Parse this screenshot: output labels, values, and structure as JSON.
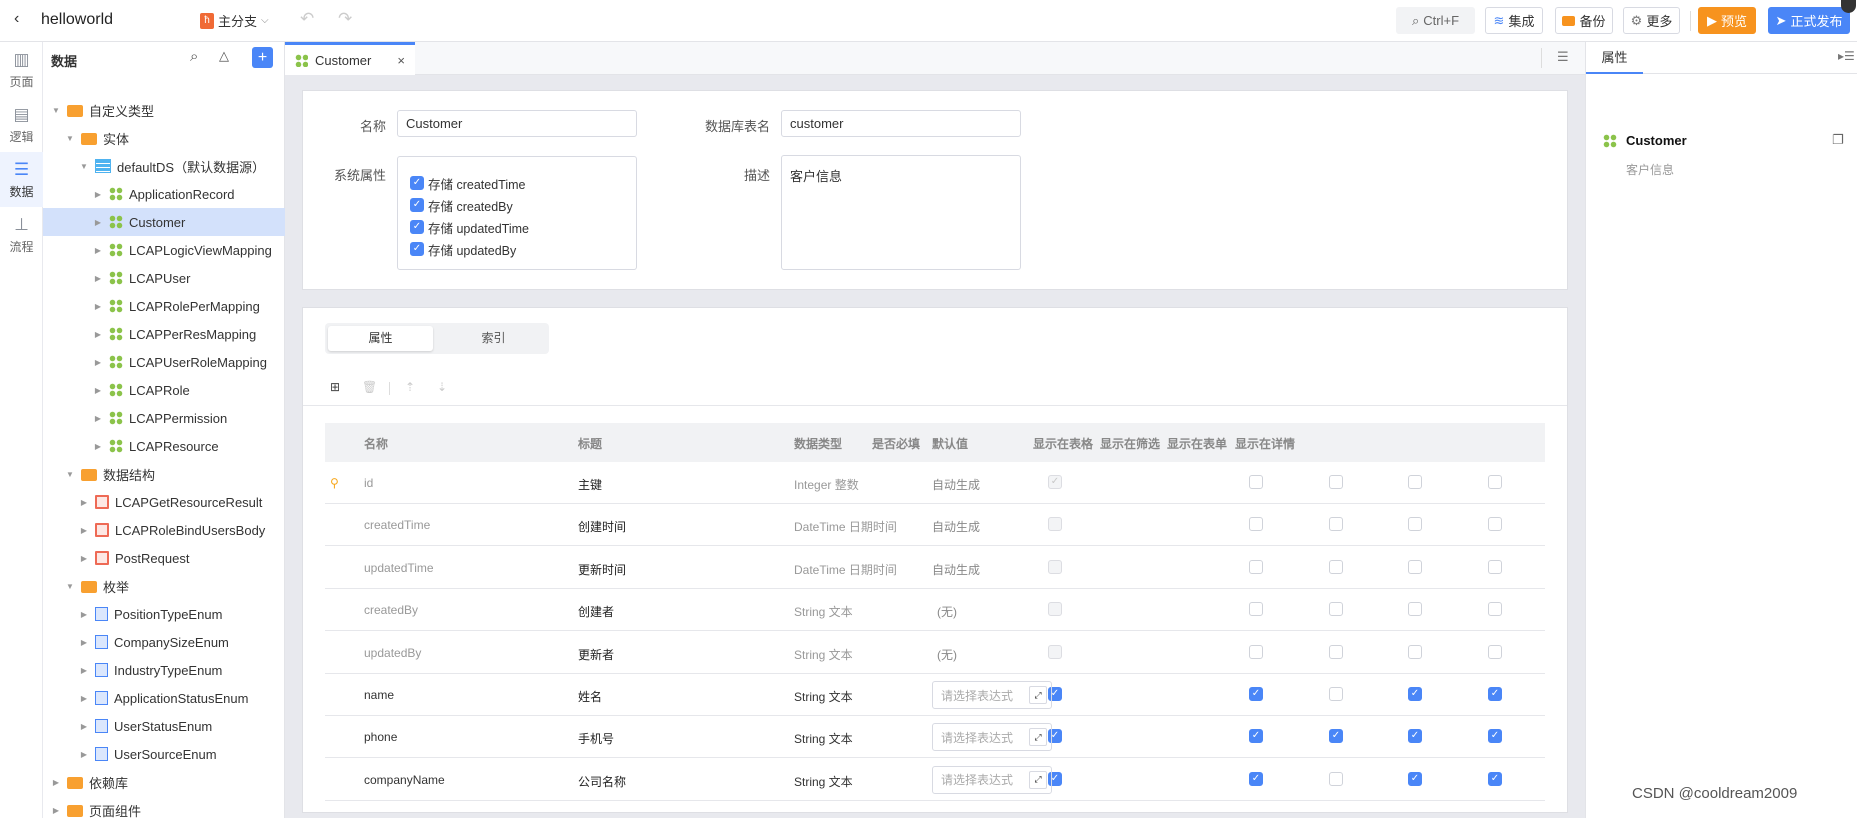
{
  "topbar": {
    "app_name": "helloworld",
    "branch": "主分支",
    "search_shortcut": "Ctrl+F",
    "integrate": "集成",
    "backup": "备份",
    "more": "更多",
    "preview": "预览",
    "publish": "正式发布",
    "preview_color": "#f7931e",
    "publish_color": "#4a86f7"
  },
  "rail": [
    {
      "label": "页面",
      "icon": "page-icon"
    },
    {
      "label": "逻辑",
      "icon": "logic-icon"
    },
    {
      "label": "数据",
      "icon": "data-icon",
      "active": true
    },
    {
      "label": "流程",
      "icon": "flow-icon"
    }
  ],
  "tree": {
    "title": "数据",
    "rows": [
      {
        "label": "自定义类型",
        "level": 0,
        "icon": "folder",
        "open": true
      },
      {
        "label": "实体",
        "level": 1,
        "icon": "folder",
        "open": true
      },
      {
        "label": "defaultDS（默认数据源）",
        "level": 2,
        "icon": "datasource",
        "open": true
      },
      {
        "label": "ApplicationRecord",
        "level": 3,
        "icon": "entity"
      },
      {
        "label": "Customer",
        "level": 3,
        "icon": "entity",
        "selected": true
      },
      {
        "label": "LCAPLogicViewMapping",
        "level": 3,
        "icon": "entity"
      },
      {
        "label": "LCAPUser",
        "level": 3,
        "icon": "entity"
      },
      {
        "label": "LCAPRolePerMapping",
        "level": 3,
        "icon": "entity"
      },
      {
        "label": "LCAPPerResMapping",
        "level": 3,
        "icon": "entity"
      },
      {
        "label": "LCAPUserRoleMapping",
        "level": 3,
        "icon": "entity"
      },
      {
        "label": "LCAPRole",
        "level": 3,
        "icon": "entity"
      },
      {
        "label": "LCAPPermission",
        "level": 3,
        "icon": "entity"
      },
      {
        "label": "LCAPResource",
        "level": 3,
        "icon": "entity"
      },
      {
        "label": "数据结构",
        "level": 1,
        "icon": "folder",
        "open": true
      },
      {
        "label": "LCAPGetResourceResult",
        "level": 2,
        "icon": "structure"
      },
      {
        "label": "LCAPRoleBindUsersBody",
        "level": 2,
        "icon": "structure"
      },
      {
        "label": "PostRequest",
        "level": 2,
        "icon": "structure"
      },
      {
        "label": "枚举",
        "level": 1,
        "icon": "folder",
        "open": true
      },
      {
        "label": "PositionTypeEnum",
        "level": 2,
        "icon": "enum"
      },
      {
        "label": "CompanySizeEnum",
        "level": 2,
        "icon": "enum"
      },
      {
        "label": "IndustryTypeEnum",
        "level": 2,
        "icon": "enum"
      },
      {
        "label": "ApplicationStatusEnum",
        "level": 2,
        "icon": "enum"
      },
      {
        "label": "UserStatusEnum",
        "level": 2,
        "icon": "enum"
      },
      {
        "label": "UserSourceEnum",
        "level": 2,
        "icon": "enum"
      },
      {
        "label": "依赖库",
        "level": 0,
        "icon": "folder",
        "open": false
      },
      {
        "label": "页面组件",
        "level": 0,
        "icon": "folder",
        "open": false
      }
    ]
  },
  "tab": {
    "label": "Customer"
  },
  "form": {
    "name_label": "名称",
    "name_value": "Customer",
    "table_label": "数据库表名",
    "table_value": "customer",
    "sys_label": "系统属性",
    "sys_items": [
      "存储 createdTime",
      "存储 createdBy",
      "存储 updatedTime",
      "存储 updatedBy"
    ],
    "desc_label": "描述",
    "desc_value": "客户信息"
  },
  "subtabs": {
    "props": "属性",
    "index": "索引"
  },
  "table": {
    "headers": [
      "名称",
      "标题",
      "数据类型",
      "是否必填",
      "默认值",
      "显示在表格",
      "显示在筛选",
      "显示在表单",
      "显示在详情"
    ],
    "placeholder": "请选择表达式",
    "rows": [
      {
        "name": "id",
        "title": "主键",
        "type": "Integer 整数",
        "system": true,
        "key": true,
        "required": "disabled-checked",
        "default": "自动生成",
        "show": [
          false,
          false,
          false,
          false
        ]
      },
      {
        "name": "createdTime",
        "title": "创建时间",
        "type": "DateTime 日期时间",
        "system": true,
        "required": "disabled",
        "default": "自动生成",
        "show": [
          false,
          false,
          false,
          false
        ]
      },
      {
        "name": "updatedTime",
        "title": "更新时间",
        "type": "DateTime 日期时间",
        "system": true,
        "required": "disabled",
        "default": "自动生成",
        "show": [
          false,
          false,
          false,
          false
        ]
      },
      {
        "name": "createdBy",
        "title": "创建者",
        "type": "String 文本",
        "system": true,
        "required": "disabled",
        "default": "(无)",
        "show": [
          false,
          false,
          false,
          false
        ]
      },
      {
        "name": "updatedBy",
        "title": "更新者",
        "type": "String 文本",
        "system": true,
        "required": "disabled",
        "default": "(无)",
        "show": [
          false,
          false,
          false,
          false
        ]
      },
      {
        "name": "name",
        "title": "姓名",
        "type": "String 文本",
        "required": "checked",
        "default": null,
        "show": [
          true,
          false,
          true,
          true
        ]
      },
      {
        "name": "phone",
        "title": "手机号",
        "type": "String 文本",
        "required": "checked",
        "default": null,
        "show": [
          true,
          true,
          true,
          true
        ]
      },
      {
        "name": "companyName",
        "title": "公司名称",
        "type": "String 文本",
        "required": "checked",
        "default": null,
        "show": [
          true,
          false,
          true,
          true
        ]
      }
    ]
  },
  "right": {
    "tab": "属性",
    "entity": "Customer",
    "desc": "客户信息"
  },
  "watermark": "CSDN @cooldream2009"
}
